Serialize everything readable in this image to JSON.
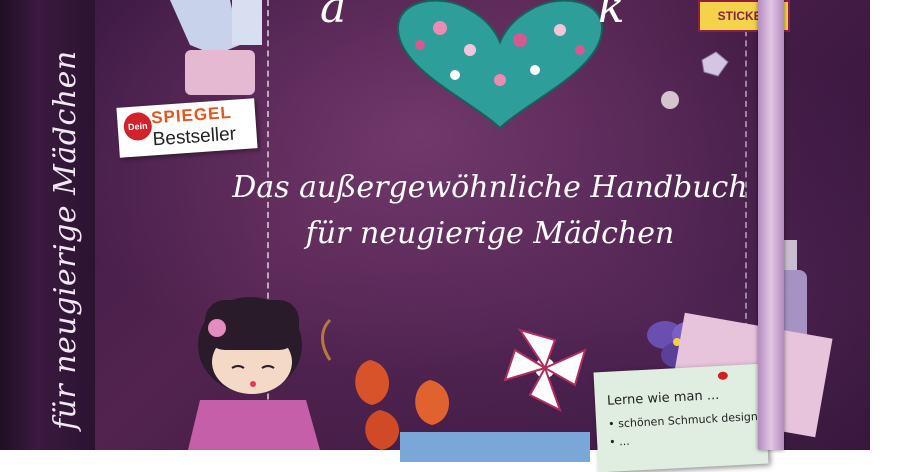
{
  "image": {
    "spine": {
      "title": "für neugierige Mädchen"
    },
    "cover": {
      "title_fragment_left": "a",
      "title_fragment_right": "k",
      "tagline_line1": "Das außergewöhnliche Handbuch",
      "tagline_line2": "für neugierige Mädchen",
      "sticker_label": "STICKER",
      "badge": {
        "dein": "Dein",
        "spiegel": "SPIEGEL",
        "bestseller": "Bestseller"
      },
      "note": {
        "title": "Lerne wie man ...",
        "item1": "schönen Schmuck designt",
        "item2": "..."
      }
    },
    "colors": {
      "cover": "#3e1a45",
      "heart": "#2e9e9a",
      "band": "#d8b6de",
      "badge_red": "#d2232a",
      "spiegel_orange": "#e8541c",
      "sticker_yellow": "#f4d24a"
    }
  }
}
